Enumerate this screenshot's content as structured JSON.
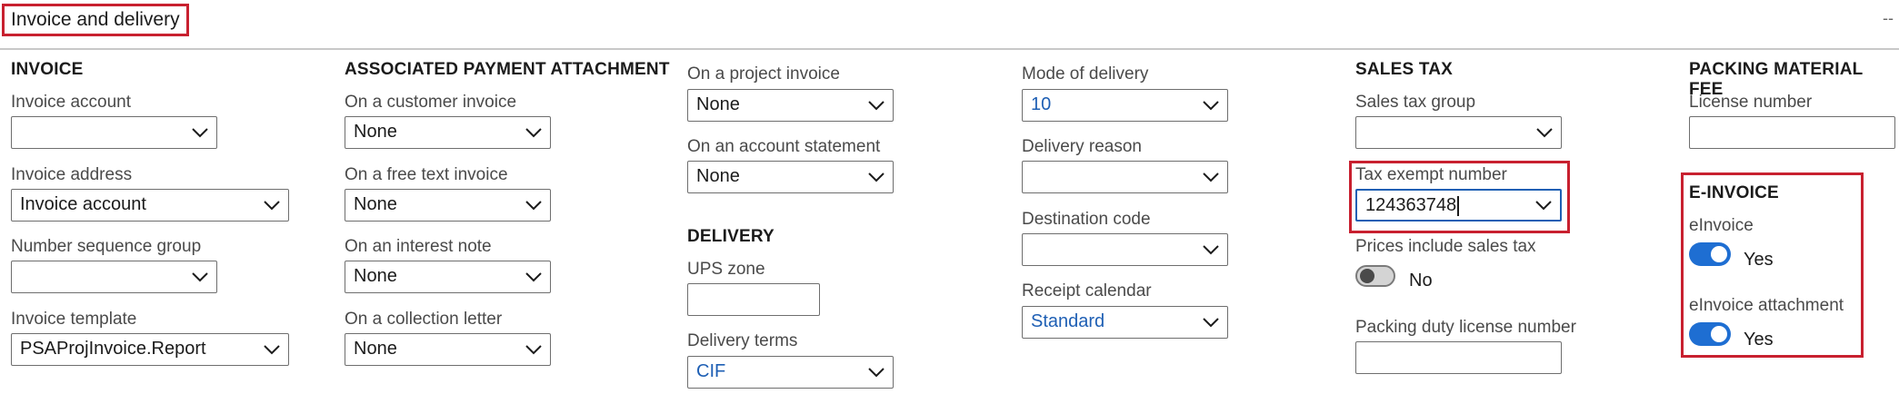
{
  "section": {
    "title": "Invoice and delivery",
    "collapse_glyph": "--"
  },
  "invoice": {
    "title": "INVOICE",
    "invoice_account": {
      "label": "Invoice account",
      "value": ""
    },
    "invoice_address": {
      "label": "Invoice address",
      "value": "Invoice account"
    },
    "number_sequence_group": {
      "label": "Number sequence group",
      "value": ""
    },
    "invoice_template": {
      "label": "Invoice template",
      "value": "PSAProjInvoice.Report"
    }
  },
  "attachment": {
    "title": "ASSOCIATED PAYMENT ATTACHMENT",
    "customer_invoice": {
      "label": "On a customer invoice",
      "value": "None"
    },
    "free_text_invoice": {
      "label": "On a free text invoice",
      "value": "None"
    },
    "interest_note": {
      "label": "On an interest note",
      "value": "None"
    },
    "collection_letter": {
      "label": "On a collection letter",
      "value": "None"
    },
    "project_invoice": {
      "label": "On a project invoice",
      "value": "None"
    },
    "account_statement": {
      "label": "On an account statement",
      "value": "None"
    }
  },
  "delivery": {
    "title": "DELIVERY",
    "ups_zone": {
      "label": "UPS zone",
      "value": ""
    },
    "delivery_terms": {
      "label": "Delivery terms",
      "value": "CIF"
    },
    "mode_of_delivery": {
      "label": "Mode of delivery",
      "value": "10"
    },
    "delivery_reason": {
      "label": "Delivery reason",
      "value": ""
    },
    "destination_code": {
      "label": "Destination code",
      "value": ""
    },
    "receipt_calendar": {
      "label": "Receipt calendar",
      "value": "Standard"
    }
  },
  "sales_tax": {
    "title": "SALES TAX",
    "sales_tax_group": {
      "label": "Sales tax group",
      "value": ""
    },
    "tax_exempt_number": {
      "label": "Tax exempt number",
      "value": "124363748"
    },
    "prices_include_tax": {
      "label": "Prices include sales tax",
      "state": "No"
    },
    "packing_duty_license": {
      "label": "Packing duty license number",
      "value": ""
    }
  },
  "packing_fee": {
    "title": "PACKING MATERIAL FEE",
    "license_number": {
      "label": "License number",
      "value": ""
    }
  },
  "einvoice": {
    "title": "E-INVOICE",
    "einvoice": {
      "label": "eInvoice",
      "state": "Yes"
    },
    "einvoice_attachment": {
      "label": "eInvoice attachment",
      "state": "Yes"
    }
  },
  "colors": {
    "accent": "#1e6ed2",
    "link": "#1e5fb4",
    "highlight": "#c8202f"
  }
}
